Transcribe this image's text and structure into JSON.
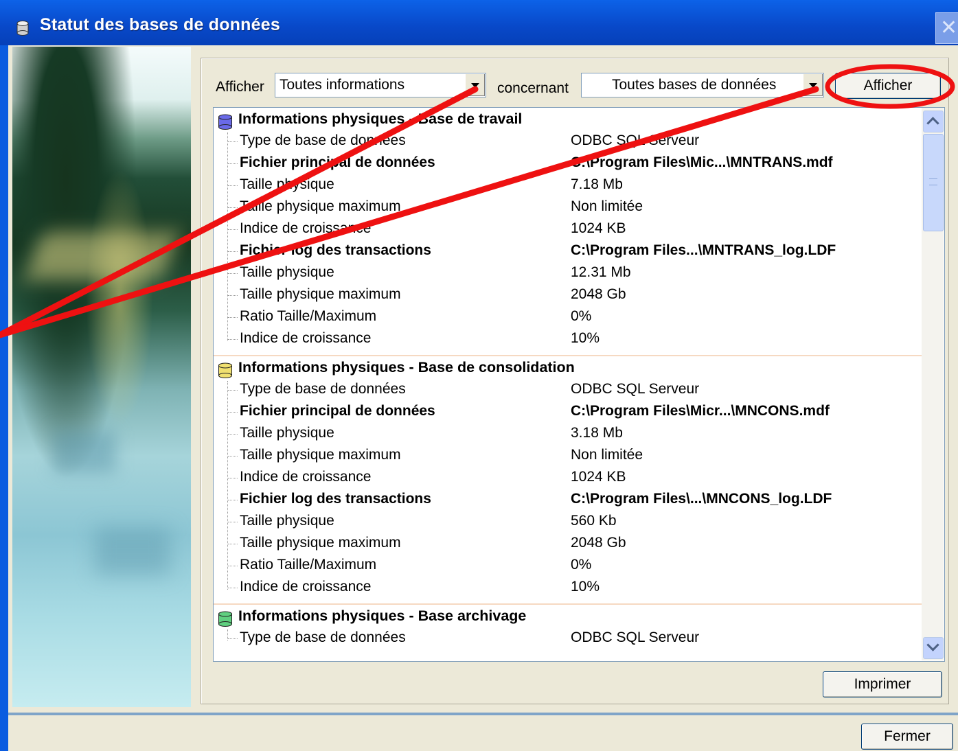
{
  "window": {
    "title": "Statut des bases de données",
    "close_glyph": "✕"
  },
  "toolbar": {
    "afficher_label": "Afficher",
    "afficher_combo_value": "Toutes informations",
    "concernant_label": "concernant",
    "concernant_combo_value": "Toutes bases de données",
    "afficher_button": "Afficher"
  },
  "sections": [
    {
      "title": "Informations physiques - Base de travail",
      "icon_color": "#6a6ae8",
      "rows": [
        {
          "k": "Type de base de données",
          "v": "ODBC SQL Serveur"
        },
        {
          "k": "Fichier principal de données",
          "v": "C:\\Program Files\\Mic...\\MNTRANS.mdf"
        },
        {
          "k": "Taille physique",
          "v": "7.18 Mb"
        },
        {
          "k": "Taille physique maximum",
          "v": "Non limitée"
        },
        {
          "k": "Indice de croissance",
          "v": "1024 KB"
        },
        {
          "k": "Fichier log des transactions",
          "v": "C:\\Program Files...\\MNTRANS_log.LDF"
        },
        {
          "k": "Taille physique",
          "v": "12.31 Mb"
        },
        {
          "k": "Taille physique maximum",
          "v": "2048 Gb"
        },
        {
          "k": "Ratio Taille/Maximum",
          "v": "0%"
        },
        {
          "k": "Indice de croissance",
          "v": "10%"
        }
      ]
    },
    {
      "title": "Informations physiques - Base de consolidation",
      "icon_color": "#f0e070",
      "rows": [
        {
          "k": "Type de base de données",
          "v": "ODBC SQL Serveur"
        },
        {
          "k": "Fichier principal de données",
          "v": "C:\\Program Files\\Micr...\\MNCONS.mdf"
        },
        {
          "k": "Taille physique",
          "v": "3.18 Mb"
        },
        {
          "k": "Taille physique maximum",
          "v": "Non limitée"
        },
        {
          "k": "Indice de croissance",
          "v": "1024 KB"
        },
        {
          "k": "Fichier log des transactions",
          "v": "C:\\Program Files\\...\\MNCONS_log.LDF"
        },
        {
          "k": "Taille physique",
          "v": "560 Kb"
        },
        {
          "k": "Taille physique maximum",
          "v": "2048 Gb"
        },
        {
          "k": "Ratio Taille/Maximum",
          "v": "0%"
        },
        {
          "k": "Indice de croissance",
          "v": "10%"
        }
      ]
    },
    {
      "title": "Informations physiques - Base archivage",
      "icon_color": "#60d080",
      "rows": [
        {
          "k": "Type de base de données",
          "v": "ODBC SQL Serveur"
        }
      ]
    }
  ],
  "buttons": {
    "imprimer": "Imprimer",
    "fermer": "Fermer"
  },
  "colors": {
    "annotation": "#ee1111",
    "titlebar": "#0848c8"
  }
}
